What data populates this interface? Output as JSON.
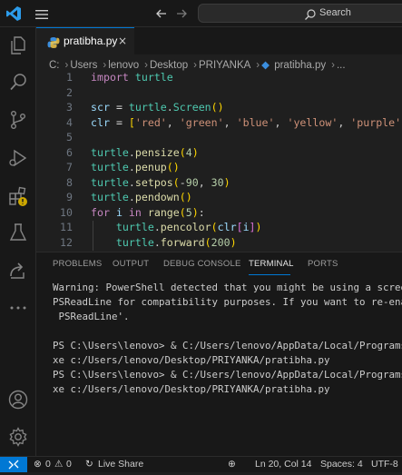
{
  "titlebar": {
    "search_placeholder": "Search",
    "icons": [
      "vscode-logo-icon",
      "menu-icon",
      "arrow-left-icon",
      "arrow-right-icon",
      "search-icon"
    ]
  },
  "activitybar": {
    "items": [
      "explorer-icon",
      "search-icon",
      "source-control-icon",
      "run-debug-icon",
      "extensions-icon",
      "testing-icon",
      "live-share-icon",
      "more-icon"
    ],
    "bottom": [
      "account-icon",
      "settings-gear-icon"
    ]
  },
  "editor": {
    "tab": {
      "label": "pratibha.py",
      "close": "×"
    },
    "breadcrumb": [
      "C:",
      "Users",
      "lenovo",
      "Desktop",
      "PRIYANKA",
      "pratibha.py",
      "..."
    ],
    "line_numbers": [
      "1",
      "2",
      "3",
      "4",
      "5",
      "6",
      "7",
      "8",
      "9",
      "10",
      "11",
      "12"
    ]
  },
  "panel": {
    "tabs": [
      "PROBLEMS",
      "OUTPUT",
      "DEBUG CONSOLE",
      "TERMINAL",
      "PORTS"
    ],
    "active_tab": "TERMINAL",
    "terminal_lines": [
      "Warning: PowerShell detected that you might be using a scree",
      "PSReadLine for compatibility purposes. If you want to re-ena",
      " PSReadLine'.",
      "",
      "PS C:\\Users\\lenovo> & C:/Users/lenovo/AppData/Local/Programs",
      "xe c:/Users/lenovo/Desktop/PRIYANKA/pratibha.py",
      "PS C:\\Users\\lenovo> & C:/Users/lenovo/AppData/Local/Programs",
      "xe c:/Users/lenovo/Desktop/PRIYANKA/pratibha.py"
    ]
  },
  "statusbar": {
    "errors": "0",
    "warnings": "0",
    "live_share": "Live Share",
    "position": "Ln 20, Col 14",
    "spaces": "Spaces: 4",
    "encoding": "UTF-8"
  },
  "colors": {
    "accent": "#0078d4",
    "keyword": "#c586c0",
    "string": "#ce9178",
    "function": "#dcdcaa",
    "variable": "#9cdcfe",
    "number": "#b5cea8"
  }
}
